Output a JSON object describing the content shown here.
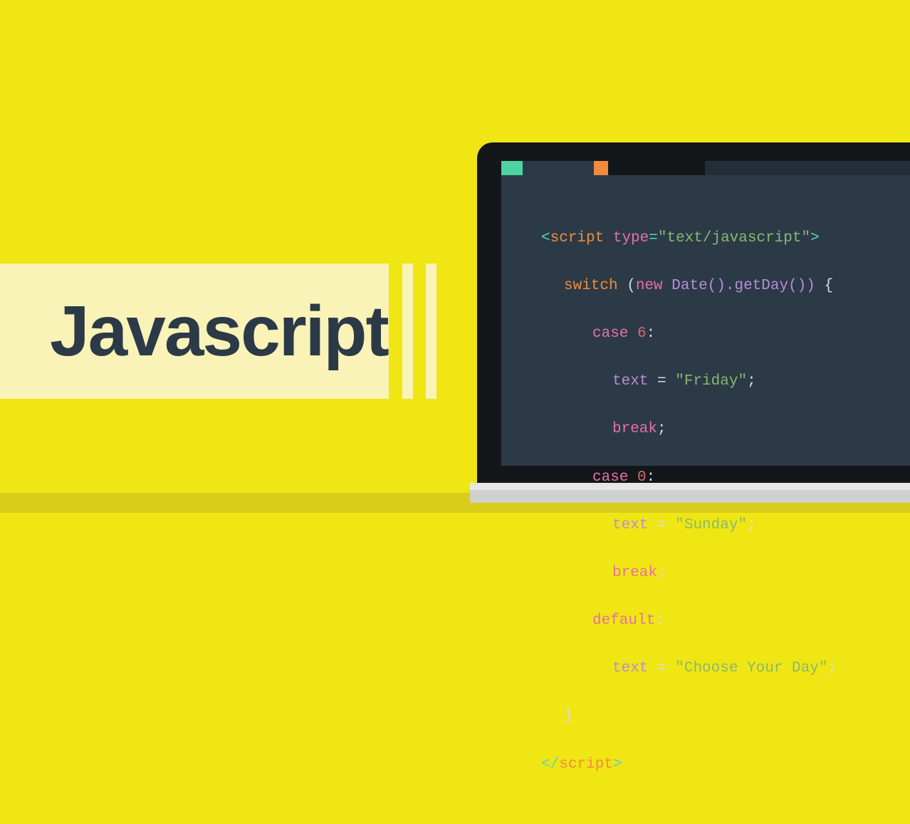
{
  "title": "Javascript",
  "code": {
    "line1": {
      "open_bracket": "<",
      "tag": "script",
      "attr_name": " type",
      "equals": "=",
      "attr_value": "\"text/javascript\"",
      "close_bracket": ">"
    },
    "line2": {
      "switch": "switch",
      "paren_open": " (",
      "new": "new",
      "date_expr": " Date().getDay()) ",
      "brace": "{"
    },
    "line3": {
      "case": "case",
      "space": " ",
      "num": "6",
      "colon": ":"
    },
    "line4": {
      "text": "text ",
      "equals": "= ",
      "value": "\"Friday\"",
      "semi": ";"
    },
    "line5": {
      "break": "break",
      "semi": ";"
    },
    "line6": {
      "case": "case",
      "space": " ",
      "num": "0",
      "colon": ":"
    },
    "line7": {
      "text": "text ",
      "equals": "= ",
      "value": "\"Sunday\"",
      "semi": ";"
    },
    "line8": {
      "break": "break",
      "semi": ";"
    },
    "line9": {
      "default": "default",
      "colon": ":"
    },
    "line10": {
      "text": "text ",
      "equals": "= ",
      "value": "\"Choose Your Day\"",
      "semi": ";"
    },
    "line11": {
      "brace": "}"
    },
    "line12": {
      "open_bracket": "</",
      "tag": "script",
      "close_bracket": ">"
    }
  }
}
